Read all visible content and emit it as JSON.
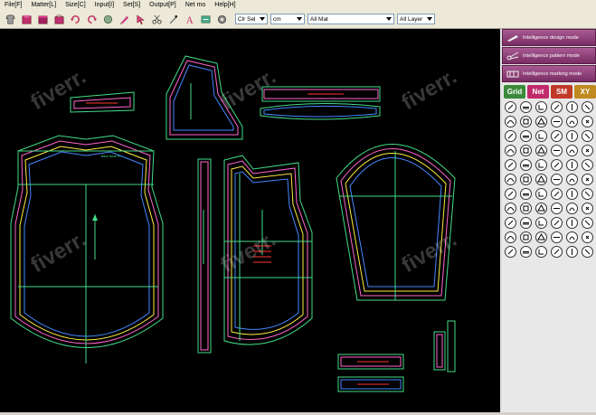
{
  "menu": [
    "File[F]",
    "Matter[L]",
    "Size[C]",
    "Input[I]",
    "Set[S]",
    "Output[P]",
    "Net mo",
    "Help[H]"
  ],
  "toolbar": {
    "icons": [
      "garment-icon",
      "books-icon",
      "fabric-icon",
      "open-icon",
      "undo-icon",
      "redo-icon",
      "circle-icon",
      "marker-icon",
      "pointer-icon",
      "scissors-icon",
      "brush-icon",
      "text-icon",
      "size-icon",
      "settings-icon"
    ],
    "clr_sel": "Clr Sel",
    "unit": "cm",
    "material": "All Mat",
    "layer": "All Layer"
  },
  "modes": [
    "Intelligence design mode",
    "Intelligence pattern mode",
    "Intelligence marking mode"
  ],
  "tabs": [
    {
      "label": "Grid",
      "color": "#3a8a3a"
    },
    {
      "label": "Net",
      "color": "#c02a6a"
    },
    {
      "label": "SM",
      "color": "#c03a2a"
    },
    {
      "label": "XY",
      "color": "#c08a20"
    }
  ],
  "watermark": "fiverr.",
  "colors": {
    "pattern": "#44dd88",
    "pink": "#ff66cc",
    "yellow": "#ffee44",
    "blue": "#4488ff",
    "red": "#ff3333"
  }
}
